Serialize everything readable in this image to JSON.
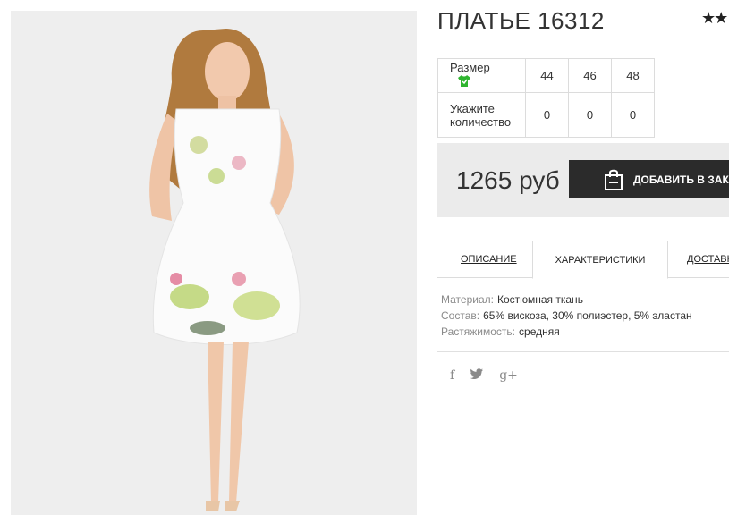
{
  "product": {
    "title": "ПЛАТЬЕ 16312",
    "stars": "★★"
  },
  "size_table": {
    "size_label": "Размер",
    "qty_label": "Укажите количество",
    "sizes": [
      "44",
      "46",
      "48"
    ],
    "quantities": [
      "0",
      "0",
      "0"
    ],
    "icon": "tshirt-icon",
    "icon_color": "#2fb52f"
  },
  "order": {
    "price": "1265 руб",
    "add_button": "ДОБАВИТЬ В ЗАКАЗ",
    "bag_icon": "shopping-bag-icon"
  },
  "tabs": {
    "description": "ОПИСАНИЕ",
    "characteristics": "ХАРАКТЕРИСТИКИ",
    "delivery": "ДОСТАВК"
  },
  "characteristics": [
    {
      "key": "Материал:",
      "value": "Костюмная ткань"
    },
    {
      "key": "Состав:",
      "value": "65% вискоза, 30% полиэстер, 5% эластан"
    },
    {
      "key": "Растяжимость:",
      "value": "средняя"
    }
  ],
  "social": {
    "facebook": "f",
    "twitter": "twitter-icon",
    "googleplus": "g+"
  }
}
